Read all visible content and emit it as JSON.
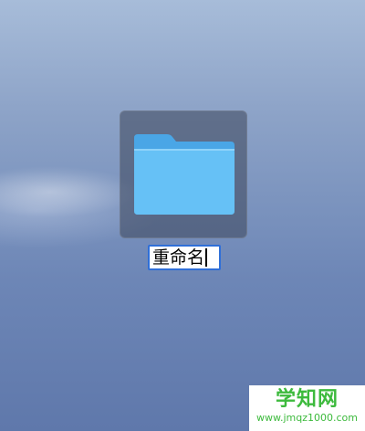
{
  "desktop": {
    "folder": {
      "icon": "folder-icon",
      "rename_value": "重命名",
      "selected": true
    }
  },
  "watermark": {
    "title": "学知网",
    "url": "www.jmqz1000.com"
  },
  "colors": {
    "selection_highlight": "#2f6fd8",
    "folder_blue": "#5fb8f2",
    "watermark_green": "#3dba3d"
  }
}
